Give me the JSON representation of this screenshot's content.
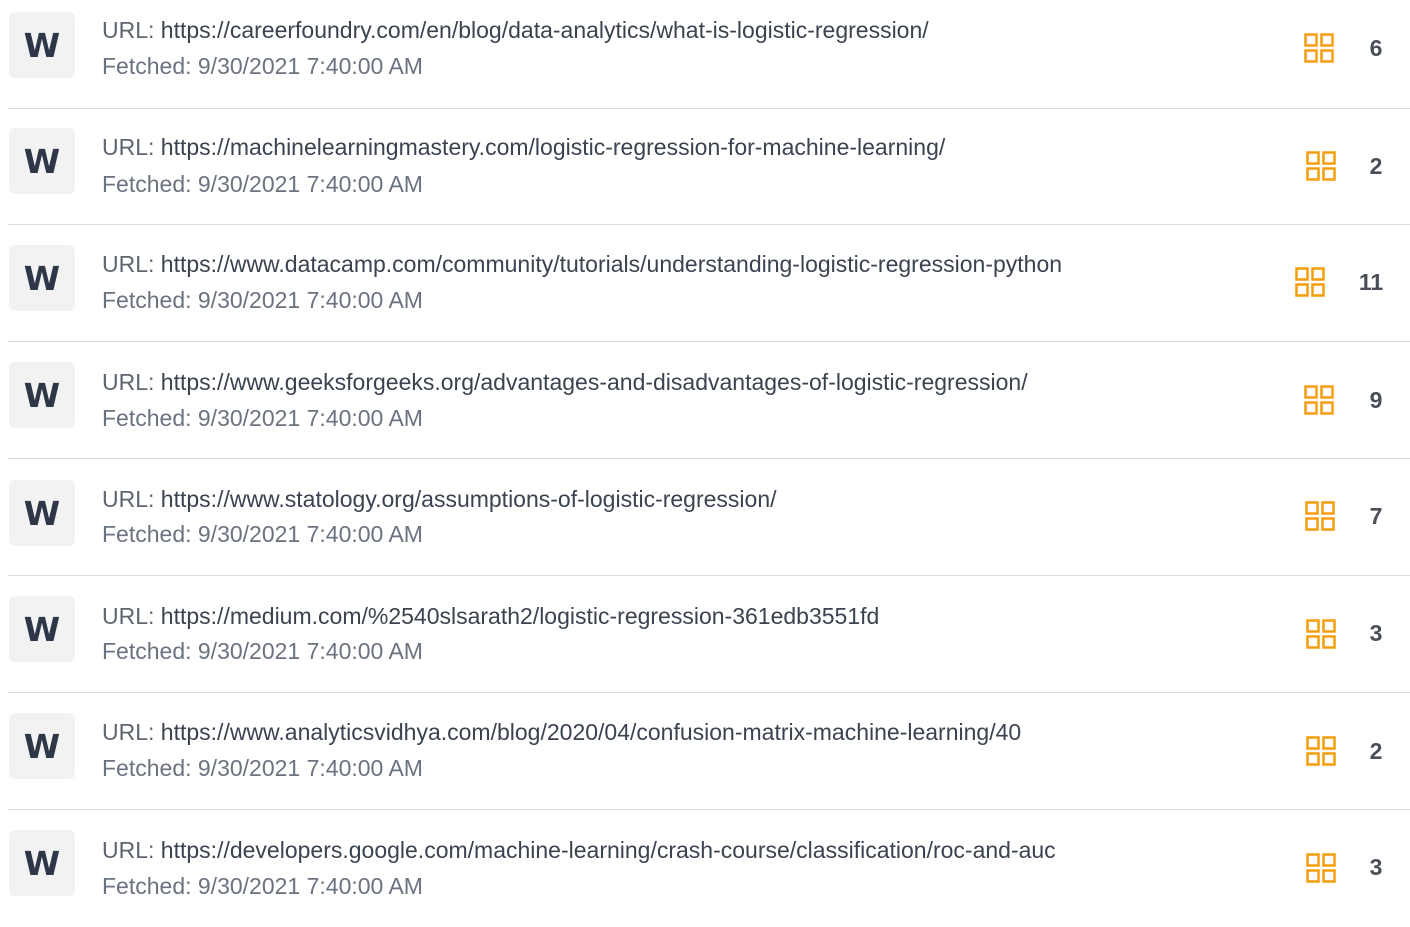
{
  "sources": [
    {
      "logo": "W",
      "url_label": "URL:",
      "url": "https://careerfoundry.com/en/blog/data-analytics/what-is-logistic-regression/",
      "fetched": "Fetched: 9/30/2021 7:40:00 AM",
      "count": "6",
      "icon": "grid-icon"
    },
    {
      "logo": "W",
      "url_label": "URL:",
      "url": "https://machinelearningmastery.com/logistic-regression-for-machine-learning/",
      "fetched": "Fetched: 9/30/2021 7:40:00 AM",
      "count": "2",
      "icon": "grid-icon"
    },
    {
      "logo": "W",
      "url_label": "URL:",
      "url": "https://www.datacamp.com/community/tutorials/understanding-logistic-regression-python",
      "fetched": "Fetched: 9/30/2021 7:40:00 AM",
      "count": "11",
      "icon": "grid-icon"
    },
    {
      "logo": "W",
      "url_label": "URL:",
      "url": "https://www.geeksforgeeks.org/advantages-and-disadvantages-of-logistic-regression/",
      "fetched": "Fetched: 9/30/2021 7:40:00 AM",
      "count": "9",
      "icon": "grid-icon"
    },
    {
      "logo": "W",
      "url_label": "URL:",
      "url": "https://www.statology.org/assumptions-of-logistic-regression/",
      "fetched": "Fetched: 9/30/2021 7:40:00 AM",
      "count": "7",
      "icon": "grid-icon"
    },
    {
      "logo": "W",
      "url_label": "URL:",
      "url": "https://medium.com/%2540slsarath2/logistic-regression-361edb3551fd",
      "fetched": "Fetched: 9/30/2021 7:40:00 AM",
      "count": "3",
      "icon": "grid-icon"
    },
    {
      "logo": "W",
      "url_label": "URL:",
      "url": "https://www.analyticsvidhya.com/blog/2020/04/confusion-matrix-machine-learning/40",
      "fetched": "Fetched: 9/30/2021 7:40:00 AM",
      "count": "2",
      "icon": "grid-icon"
    },
    {
      "logo": "W",
      "url_label": "URL:",
      "url": "https://developers.google.com/machine-learning/crash-course/classification/roc-and-auc",
      "fetched": "Fetched: 9/30/2021 7:40:00 AM",
      "count": "3",
      "icon": "grid-icon"
    }
  ],
  "colors": {
    "accent_orange": "#f59e0b",
    "logo_background": "#f2f2f2",
    "logo_text": "#2d3748",
    "divider": "#d9d9d9"
  }
}
